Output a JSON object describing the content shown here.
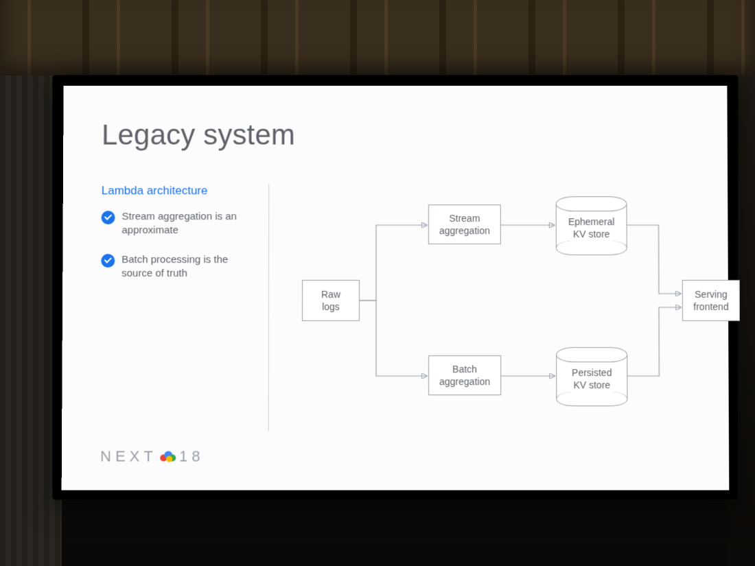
{
  "slide": {
    "title": "Legacy system",
    "subtitle": "Lambda architecture",
    "bullets": [
      "Stream aggregation is an approximate",
      "Batch processing is the source of truth"
    ],
    "footer_logo_text": "NEXT",
    "footer_logo_suffix": "18"
  },
  "diagram": {
    "nodes": {
      "raw_logs": "Raw\nlogs",
      "stream_agg": "Stream\naggregation",
      "batch_agg": "Batch\naggregation",
      "ephemeral_kv": "Ephemeral\nKV store",
      "persisted_kv": "Persisted\nKV store",
      "serving": "Serving\nfrontend"
    },
    "edges": [
      {
        "from": "raw_logs",
        "to": "stream_agg"
      },
      {
        "from": "raw_logs",
        "to": "batch_agg"
      },
      {
        "from": "stream_agg",
        "to": "ephemeral_kv"
      },
      {
        "from": "batch_agg",
        "to": "persisted_kv"
      },
      {
        "from": "ephemeral_kv",
        "to": "serving"
      },
      {
        "from": "persisted_kv",
        "to": "serving"
      }
    ]
  },
  "colors": {
    "accent_blue": "#1a73e8",
    "line_gray": "#9aa0a6",
    "text_gray": "#5f6368"
  }
}
